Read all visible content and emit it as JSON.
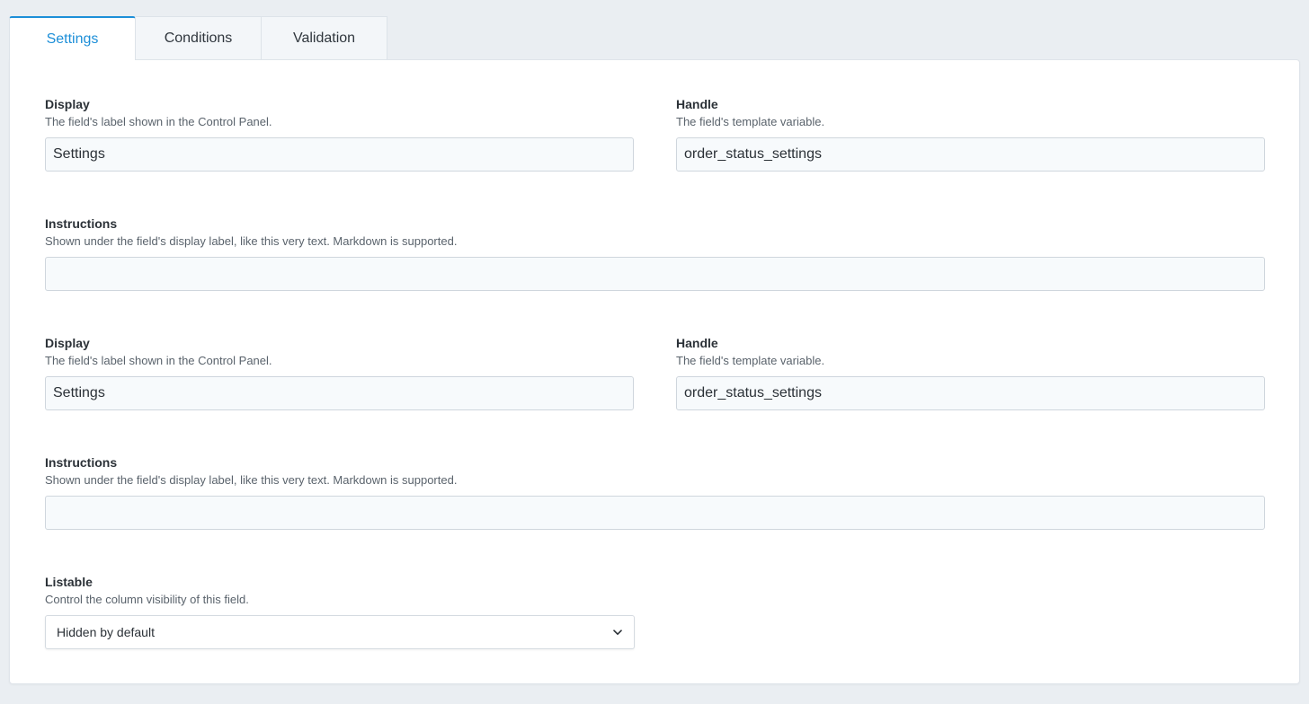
{
  "tabs": [
    {
      "label": "Settings",
      "active": true
    },
    {
      "label": "Conditions",
      "active": false
    },
    {
      "label": "Validation",
      "active": false
    }
  ],
  "sections": [
    {
      "display": {
        "label": "Display",
        "help": "The field's label shown in the Control Panel.",
        "value": "Settings"
      },
      "handle": {
        "label": "Handle",
        "help": "The field's template variable.",
        "value": "order_status_settings"
      },
      "instructions": {
        "label": "Instructions",
        "help": "Shown under the field's display label, like this very text. Markdown is supported.",
        "value": ""
      }
    },
    {
      "display": {
        "label": "Display",
        "help": "The field's label shown in the Control Panel.",
        "value": "Settings"
      },
      "handle": {
        "label": "Handle",
        "help": "The field's template variable.",
        "value": "order_status_settings"
      },
      "instructions": {
        "label": "Instructions",
        "help": "Shown under the field's display label, like this very text. Markdown is supported.",
        "value": ""
      }
    }
  ],
  "listable": {
    "label": "Listable",
    "help": "Control the column visibility of this field.",
    "selected": "Hidden by default",
    "icon": "chevron-down-icon"
  },
  "colors": {
    "accent": "#1d8fd8",
    "background": "#eaeef2",
    "input_bg": "#f7fafc"
  }
}
